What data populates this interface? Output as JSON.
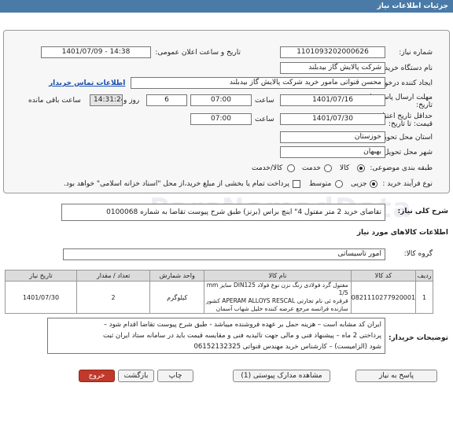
{
  "window": {
    "title": "جزئیات اطلاعات نیاز"
  },
  "form": {
    "need_number_label": "شماره نیاز:",
    "need_number": "1101093202000626",
    "announce_label": "تاریخ و ساعت اعلان عمومی:",
    "announce_value": "1401/07/09 - 14:38",
    "buyer_org_label": "نام دستگاه خریدار:",
    "buyer_org": "شرکت پالایش گاز بیدبلند",
    "creator_label": "ایجاد کننده درخواست:",
    "creator": "محسن قنواتی مامور خرید شرکت پالایش گاز بیدبلند",
    "contact_link": "اطلاعات تماس خریدار",
    "deadline_label": "مهلت ارسال پاسخ: تا تاریخ:",
    "deadline_date": "1401/07/16",
    "time_label": "ساعت",
    "deadline_time": "07:00",
    "days_value": "6",
    "days_label": "روز و",
    "remaining_time": "14:31:24",
    "remaining_label": "ساعت باقی مانده",
    "validity_label": "حداقل تاریخ اعتبار قیمت: تا تاریخ:",
    "validity_date": "1401/07/30",
    "validity_time_label": "ساعت",
    "validity_time": "07:00",
    "province_label": "استان محل تحویل:",
    "province": "خوزستان",
    "city_label": "شهر محل تحویل:",
    "city": "بهبهان",
    "category_label": "طبقه بندی موضوعی:",
    "category_options": [
      "کالا",
      "خدمت",
      "کالا/خدمت"
    ],
    "process_label": "نوع فرآیند خرید :",
    "process_options": [
      "جزیی",
      "متوسط"
    ],
    "payment_note": "پرداخت تمام یا بخشی از مبلغ خرید،از محل \"اسناد خزانه اسلامی\" خواهد بود."
  },
  "summary": {
    "label": "شرح کلی نیاز:",
    "text": "تقاضای خرید 2 متر مفتول  4\" اینچ براس (برنز) طبق شرح پیوست تقاضا به شماره 0100068"
  },
  "goods": {
    "section_title": "اطلاعات کالاهای مورد نیاز",
    "group_label": "گروه کالا:",
    "group_value": "امور تاسیساتی",
    "columns": [
      "ردیف",
      "کد کالا",
      "نام کالا",
      "واحد شمارش",
      "تعداد / مقدار",
      "تاریخ نیاز"
    ],
    "rows": [
      {
        "row": "1",
        "code": "0821110277920001",
        "name_l1": "مفتول گرد فولادی زنگ نزن نوع فولاد DIN125 سایز mm 1/5",
        "name_l2": "قرقره ئی نام تجارتی APERAM ALLOYS RESCAL کشور",
        "name_l3": "سازنده فرانسه مرجع عرضه کننده خلیل شهاب آسمان",
        "unit": "کیلوگرم",
        "qty": "2",
        "date": "1401/07/30"
      }
    ]
  },
  "notes": {
    "label": "توضیحات خریدار:",
    "l1": "ایران کد مشابه است  – هزینه حمل بر عهده فروشنده میباشد -  طبق شرح پیوست تقاضا اقدام شود –",
    "l2": "پرداختی 2 ماه – پیشنهاد فنی و مالی جهت تائیدیه فنی و مقایسه قیمت باید در سامانه ستاد ایران ثبت",
    "l3": "شود (الزامیست) – کارشناس خرید  مهندس قنواتی 06152132325"
  },
  "buttons": {
    "reply": "پاسخ به نیاز",
    "docs": "مشاهده مدارک پیوستی (1)",
    "print": "چاپ",
    "back": "بازگشت",
    "exit": "خروج"
  },
  "watermark": {
    "text": "ParsNamadData"
  },
  "colors": {
    "titlebar": "#4a7aa8",
    "exit_button": "#c0392b",
    "link": "#1a4fb0"
  }
}
